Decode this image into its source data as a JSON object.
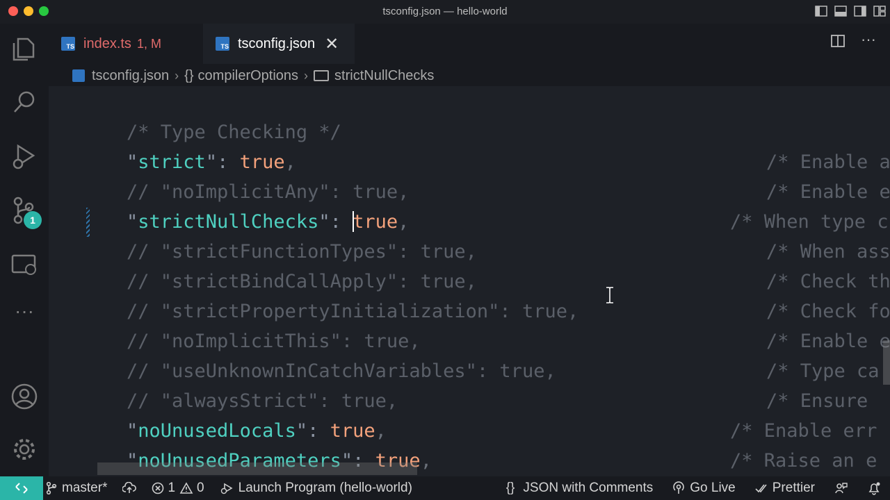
{
  "window": {
    "title": "tsconfig.json — hello-world"
  },
  "tabs": [
    {
      "label": "index.ts",
      "status": "1, M",
      "icon": "ts-file-icon"
    },
    {
      "label": "tsconfig.json",
      "icon": "ts-file-icon",
      "close": "✕"
    }
  ],
  "breadcrumb": {
    "file": "tsconfig.json",
    "brace": "{}",
    "section": "compilerOptions",
    "key": "strictNullChecks"
  },
  "activity_bar": {
    "source_control_badge": "1"
  },
  "code": {
    "lines": [
      {
        "text": "/* Type Checking */",
        "right": ""
      },
      {
        "key": "strict",
        "value": "true",
        "commented": false,
        "right": "/* Enable a"
      },
      {
        "text": "// \"noImplicitAny\": true,",
        "right": "/* Enable e"
      },
      {
        "key": "strictNullChecks",
        "value": "true",
        "commented": false,
        "right": "/* When type c"
      },
      {
        "text": "// \"strictFunctionTypes\": true,",
        "right": "/* When ass"
      },
      {
        "text": "// \"strictBindCallApply\": true,",
        "right": "/* Check th"
      },
      {
        "text": "// \"strictPropertyInitialization\": true,",
        "right": "/* Check fo"
      },
      {
        "text": "// \"noImplicitThis\": true,",
        "right": "/* Enable e"
      },
      {
        "text": "// \"useUnknownInCatchVariables\": true,",
        "right": "/* Type ca"
      },
      {
        "text": "// \"alwaysStrict\": true,",
        "right": "/* Ensure "
      },
      {
        "key": "noUnusedLocals",
        "value": "true",
        "commented": false,
        "right": "/* Enable err"
      },
      {
        "key": "noUnusedParameters",
        "value": "true",
        "commented": false,
        "right": "/* Raise an e"
      }
    ]
  },
  "statusbar": {
    "remote_icon": "remote-icon",
    "branch": "master*",
    "errors": "1",
    "warnings": "0",
    "launch": "Launch Program (hello-world)",
    "language": "JSON with Comments",
    "language_icon": "{}",
    "golive": "Go Live",
    "prettier": "Prettier"
  },
  "colors": {
    "accent": "#2bb5a8",
    "key": "#4fd1c1",
    "boolean": "#f4a27c",
    "comment": "#5b6069",
    "error_tab": "#e06b6b"
  }
}
